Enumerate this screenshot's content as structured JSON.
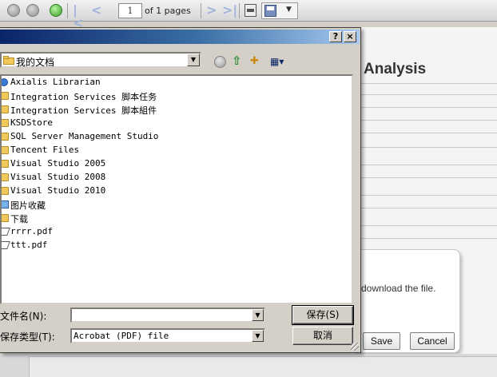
{
  "toolbar": {
    "page_number": "1",
    "page_of": "of 1 pages",
    "icons": [
      "back-icon",
      "forward-icon",
      "refresh-icon",
      "first-page-icon",
      "prev-page-icon",
      "next-page-icon",
      "last-page-icon",
      "print-icon",
      "save-icon"
    ]
  },
  "report": {
    "title": "Analysis",
    "download_text": "download the file.",
    "save_label": "Save",
    "cancel_label": "Cancel"
  },
  "dialog": {
    "help_label": "?",
    "close_label": "×",
    "look_in": "我的文档",
    "files": [
      {
        "name": "Axialis Librarian",
        "icon": "star"
      },
      {
        "name": "Integration Services 脚本任务",
        "icon": "folder"
      },
      {
        "name": "Integration Services 脚本組件",
        "icon": "folder"
      },
      {
        "name": "KSDStore",
        "icon": "folder"
      },
      {
        "name": "SQL Server Management Studio",
        "icon": "folder"
      },
      {
        "name": "Tencent Files",
        "icon": "folder"
      },
      {
        "name": "Visual Studio 2005",
        "icon": "folder"
      },
      {
        "name": "Visual Studio 2008",
        "icon": "folder"
      },
      {
        "name": "Visual Studio 2010",
        "icon": "folder"
      },
      {
        "name": "图片收藏",
        "icon": "pictures"
      },
      {
        "name": "下载",
        "icon": "folder"
      },
      {
        "name": "rrrr.pdf",
        "icon": "pdf"
      },
      {
        "name": "ttt.pdf",
        "icon": "pdf"
      }
    ],
    "filename_label": "文件名(N):",
    "filename_value": "",
    "filetype_label": "保存类型(T):",
    "filetype_value": "Acrobat (PDF) file",
    "save_button": "保存(S)",
    "cancel_button": "取消"
  }
}
